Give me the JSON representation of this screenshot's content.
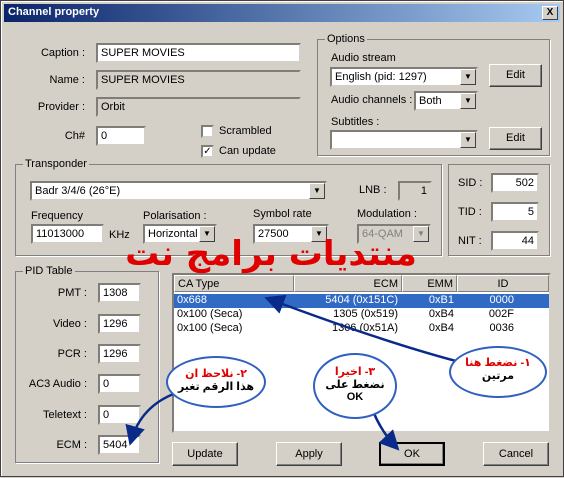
{
  "window": {
    "title": "Channel property",
    "close": "X"
  },
  "channel": {
    "caption_label": "Caption :",
    "caption": "SUPER MOVIES",
    "name_label": "Name :",
    "name": "SUPER MOVIES",
    "provider_label": "Provider :",
    "provider": "Orbit",
    "chnum_label": "Ch#",
    "chnum": "0",
    "scrambled_label": "Scrambled",
    "canupdate_label": "Can update"
  },
  "options": {
    "title": "Options",
    "audio_stream_label": "Audio stream",
    "audio_stream": "English  (pid: 1297)",
    "audio_channels_label": "Audio channels :",
    "audio_channels": "Both",
    "subtitles_label": "Subtitles :",
    "subtitles": "",
    "edit1": "Edit",
    "edit2": "Edit"
  },
  "transponder": {
    "title": "Transponder",
    "sat": "Badr 3/4/6 (26°E)",
    "lnb_label": "LNB :",
    "lnb": "1",
    "freq_label": "Frequency",
    "freq": "11013000",
    "freq_unit": "KHz",
    "pol_label": "Polarisation :",
    "pol": "Horizontal",
    "sr_label": "Symbol rate",
    "sr": "27500",
    "mod_label": "Modulation :",
    "mod": "64-QAM",
    "sid_label": "SID :",
    "sid": "502",
    "tid_label": "TID :",
    "tid": "5",
    "nit_label": "NIT :",
    "nit": "44"
  },
  "pid": {
    "title": "PID Table",
    "pmt_label": "PMT :",
    "pmt": "1308",
    "video_label": "Video :",
    "video": "1296",
    "pcr_label": "PCR :",
    "pcr": "1296",
    "ac3_label": "AC3 Audio :",
    "ac3": "0",
    "teletext_label": "Teletext :",
    "teletext": "0",
    "ecm_label": "ECM :",
    "ecm": "5404"
  },
  "ca_list": {
    "headers": [
      "CA Type",
      "ECM",
      "EMM",
      "ID"
    ],
    "rows": [
      [
        "0x668",
        "5404 (0x151C)",
        "0xB1",
        "0000"
      ],
      [
        "0x100 (Seca)",
        "1305 (0x519)",
        "0xB4",
        "002F"
      ],
      [
        "0x100 (Seca)",
        "1306 (0x51A)",
        "0xB4",
        "0036"
      ]
    ]
  },
  "buttons": {
    "update": "Update",
    "apply": "Apply",
    "ok": "OK",
    "cancel": "Cancel"
  },
  "overlay": {
    "watermark": "منتديات برامج نت",
    "note1_a": "١- نضغط هنا",
    "note1_b": "مرتين",
    "note2_a": "٢- نلاحظ ان",
    "note2_b": "هذا الرقم تغير",
    "note3_a": "٣- اخيرا",
    "note3_b": "نضغط على",
    "note3_c": "OK",
    "accent": "#e00000",
    "bubble_border": "#3060c0"
  }
}
